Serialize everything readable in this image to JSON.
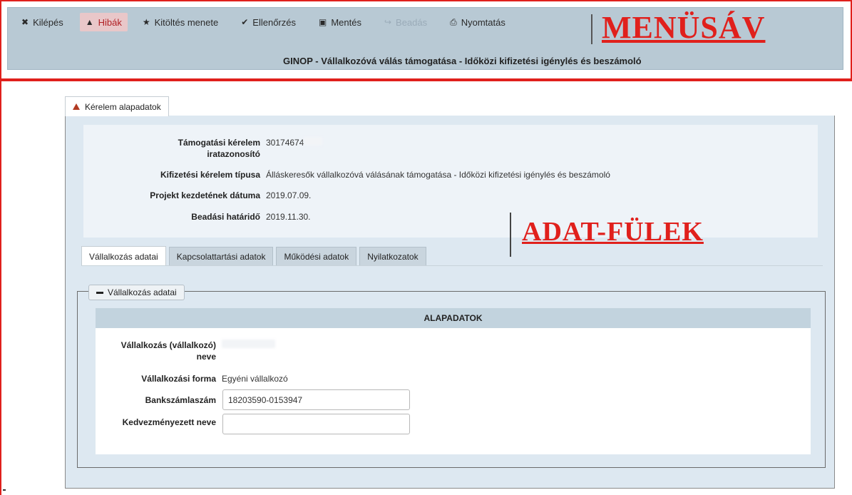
{
  "menu": {
    "items": [
      {
        "icon": "close-icon",
        "glyph": "✖",
        "label": "Kilépés"
      },
      {
        "icon": "warning-icon",
        "glyph": "▲",
        "label": "Hibák"
      },
      {
        "icon": "star-icon",
        "glyph": "★",
        "label": "Kitöltés menete"
      },
      {
        "icon": "check-icon",
        "glyph": "✔",
        "label": "Ellenőrzés"
      },
      {
        "icon": "save-icon",
        "glyph": "▣",
        "label": "Mentés"
      },
      {
        "icon": "submit-icon",
        "glyph": "↪",
        "label": "Beadás"
      },
      {
        "icon": "print-icon",
        "glyph": "⎙",
        "label": "Nyomtatás"
      }
    ],
    "title": "GINOP - Vállalkozóvá válás támogatása - Időközi kifizetési igénylés és beszámoló"
  },
  "annotations": {
    "menu_label": "MENÜSÁV",
    "tabs_label": "ADAT-FÜLEK"
  },
  "main_tab": {
    "label": "Kérelem alapadatok"
  },
  "info": [
    {
      "label": "Támogatási kérelem iratazonosító",
      "value": "30174674"
    },
    {
      "label": "Kifizetési kérelem típusa",
      "value": "Álláskeresők vállalkozóvá válásának támogatása - Időközi kifizetési igénylés és beszámoló"
    },
    {
      "label": "Projekt kezdetének dátuma",
      "value": "2019.07.09."
    },
    {
      "label": "Beadási határidő",
      "value": "2019.11.30."
    }
  ],
  "sub_tabs": [
    "Vállalkozás adatai",
    "Kapcsolattartási adatok",
    "Működési adatok",
    "Nyilatkozatok"
  ],
  "fieldset": {
    "legend": "Vállalkozás adatai",
    "section_title": "ALAPADATOK",
    "fields": [
      {
        "label": "Vállalkozás (vállalkozó) neve",
        "value": ""
      },
      {
        "label": "Vállalkozási forma",
        "value": "Egyéni vállalkozó"
      },
      {
        "label": "Bankszámlaszám",
        "value": "18203590-0153947"
      },
      {
        "label": "Kedvezményezett neve",
        "value": ""
      }
    ]
  },
  "colors": {
    "annotation_red": "#e0201c",
    "menubar_bg": "#b8c9d4",
    "panel_bg": "#dde8f1",
    "section_header_bg": "#c2d3de",
    "error_bg": "#e9c7c9"
  }
}
